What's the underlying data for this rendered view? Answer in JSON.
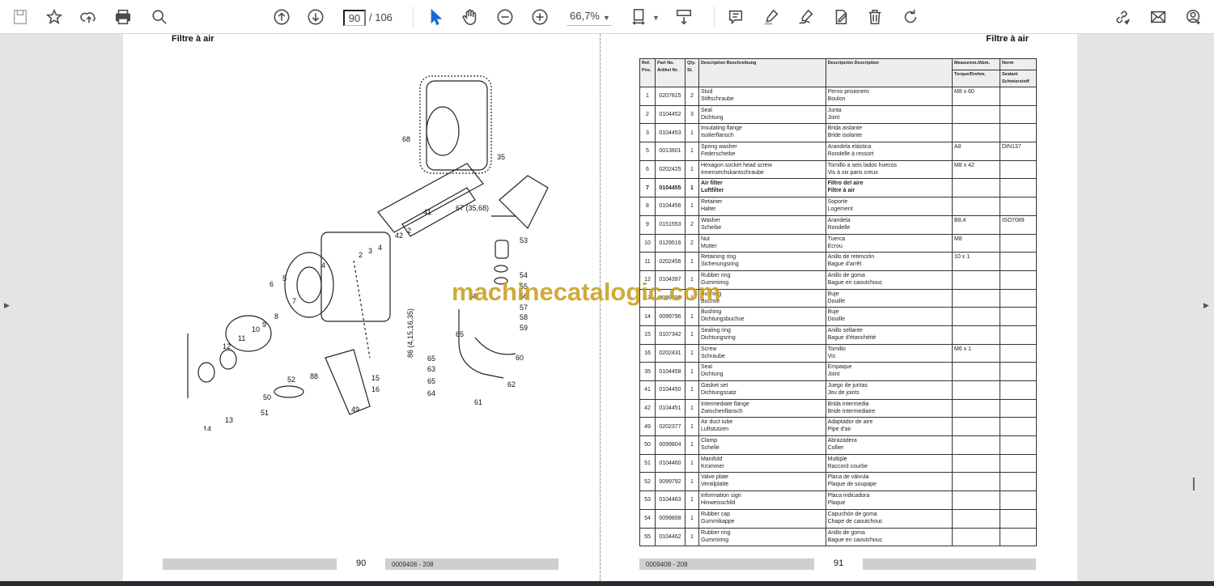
{
  "toolbar": {
    "page_current": "90",
    "page_total": "/ 106",
    "zoom": "66,7%",
    "icons": [
      "save-icon",
      "bookmark-star-icon",
      "upload-icon",
      "print-icon",
      "search-icon",
      "page-up-icon",
      "page-down-icon",
      "select-arrow-icon",
      "hand-icon",
      "zoom-out-icon",
      "zoom-in-icon",
      "fit-page-icon",
      "scroll-mode-icon",
      "comment-icon",
      "highlight-icon",
      "sign-icon",
      "fill-sign-icon",
      "delete-icon",
      "rotate-icon",
      "link-icon",
      "email-icon",
      "account-icon"
    ]
  },
  "left_page": {
    "title": "Filtre à air",
    "figure_id": "wc_ex0114499001_15",
    "page_number": "90",
    "doc_number": "0009408 - 208",
    "callouts": [
      "68",
      "35",
      "41",
      "67 (35,68)",
      "2",
      "42",
      "2",
      "3",
      "4",
      "53",
      "54",
      "55",
      "56",
      "57",
      "58",
      "59",
      "66",
      "60",
      "62",
      "61",
      "65",
      "65",
      "63",
      "65",
      "64",
      "88",
      "15",
      "16",
      "86 (4,15,16,35)",
      "49",
      "50",
      "51",
      "52",
      "14",
      "13",
      "12",
      "11",
      "10",
      "9",
      "8",
      "7",
      "6",
      "5",
      "4"
    ]
  },
  "right_page": {
    "title": "Filtre à air",
    "page_number": "91",
    "doc_number": "0009408 - 208",
    "headers": {
      "ref": "Ref. Pos.",
      "part": "Part No. Artikel Nr.",
      "qty": "Qty. St.",
      "desc": "Description Beschreibung",
      "desc2": "Descripción Description",
      "measure": "Measurem./Abm.",
      "torque": "Torque/Drehm.",
      "norm": "Norm",
      "sealant": "Sealant Schmierstoff"
    },
    "rows": [
      {
        "ref": "1",
        "part": "0207815",
        "qty": "2",
        "en": "Stud",
        "de": "Stiftschraube",
        "es": "Perno prisionero",
        "fr": "Boulon",
        "measure": "M8 x 60",
        "norm": ""
      },
      {
        "ref": "2",
        "part": "0104452",
        "qty": "3",
        "en": "Seal",
        "de": "Dichtung",
        "es": "Junta",
        "fr": "Joint",
        "measure": "",
        "norm": ""
      },
      {
        "ref": "3",
        "part": "0104453",
        "qty": "1",
        "en": "Insulating flange",
        "de": "Isolierflansch",
        "es": "Brida aislante",
        "fr": "Bride isolante",
        "measure": "",
        "norm": ""
      },
      {
        "ref": "5",
        "part": "0013601",
        "qty": "1",
        "en": "Spring washer",
        "de": "Federscheibe",
        "es": "Arandela elástica",
        "fr": "Rondelle à ressort",
        "measure": "A8",
        "norm": "DIN137"
      },
      {
        "ref": "6",
        "part": "0202425",
        "qty": "1",
        "en": "Hexagon socket head screw",
        "de": "Innensechskantschraube",
        "es": "Tornillo a seis lados huecos",
        "fr": "Vis à six pans creux",
        "measure": "M8 x 42",
        "norm": ""
      },
      {
        "ref": "7",
        "part": "0104455",
        "qty": "1",
        "en": "Air filter",
        "de": "Luftfilter",
        "es": "Filtro del aire",
        "fr": "Filtre à air",
        "measure": "",
        "norm": "",
        "bold": true
      },
      {
        "ref": "8",
        "part": "0104456",
        "qty": "1",
        "en": "Retainer",
        "de": "Halter",
        "es": "Soporte",
        "fr": "Logement",
        "measure": "",
        "norm": ""
      },
      {
        "ref": "9",
        "part": "0151553",
        "qty": "2",
        "en": "Washer",
        "de": "Scheibe",
        "es": "Arandela",
        "fr": "Rondelle",
        "measure": "B8,4",
        "norm": "ISO7089"
      },
      {
        "ref": "10",
        "part": "0129516",
        "qty": "2",
        "en": "Nut",
        "de": "Mutter",
        "es": "Tuerca",
        "fr": "Ecrou",
        "measure": "M8",
        "norm": ""
      },
      {
        "ref": "11",
        "part": "0202456",
        "qty": "1",
        "en": "Retaining ring",
        "de": "Sicherungsring",
        "es": "Anillo de retención",
        "fr": "Bague d'arrêt",
        "measure": "10 x 1",
        "norm": ""
      },
      {
        "ref": "12",
        "part": "0104397",
        "qty": "1",
        "en": "Rubber ring",
        "de": "Gummiring",
        "es": "Anillo de goma",
        "fr": "Bague en caoutchouc",
        "measure": "",
        "norm": ""
      },
      {
        "ref": "13",
        "part": "0099795",
        "qty": "1",
        "en": "Bushing",
        "de": "Buchse",
        "es": "Buje",
        "fr": "Douille",
        "measure": "",
        "norm": ""
      },
      {
        "ref": "14",
        "part": "0099796",
        "qty": "1",
        "en": "Bushing",
        "de": "Dichtungsbuchse",
        "es": "Buje",
        "fr": "Douille",
        "measure": "",
        "norm": ""
      },
      {
        "ref": "15",
        "part": "0107342",
        "qty": "1",
        "en": "Sealing ring",
        "de": "Dichtungsring",
        "es": "Anillo sellante",
        "fr": "Bague d'étanchéité",
        "measure": "",
        "norm": ""
      },
      {
        "ref": "16",
        "part": "0202431",
        "qty": "1",
        "en": "Screw",
        "de": "Schraube",
        "es": "Tornillo",
        "fr": "Vis",
        "measure": "M6 x 1",
        "norm": ""
      },
      {
        "ref": "35",
        "part": "0104458",
        "qty": "1",
        "en": "Seal",
        "de": "Dichtung",
        "es": "Empaque",
        "fr": "Joint",
        "measure": "",
        "norm": ""
      },
      {
        "ref": "41",
        "part": "0104450",
        "qty": "1",
        "en": "Gasket set",
        "de": "Dichtungssatz",
        "es": "Juego de juntas",
        "fr": "Jeu de joints",
        "measure": "",
        "norm": ""
      },
      {
        "ref": "42",
        "part": "0104451",
        "qty": "1",
        "en": "Intermediate flange",
        "de": "Zwischenflansch",
        "es": "Brida intermedia",
        "fr": "Bride intermediaire",
        "measure": "",
        "norm": ""
      },
      {
        "ref": "49",
        "part": "0202377",
        "qty": "1",
        "en": "Air duct tube",
        "de": "Luftstutzen",
        "es": "Adaptador de aire",
        "fr": "Pipe d'air",
        "measure": "",
        "norm": ""
      },
      {
        "ref": "50",
        "part": "0099804",
        "qty": "1",
        "en": "Clamp",
        "de": "Schelle",
        "es": "Abrazadera",
        "fr": "Collier",
        "measure": "",
        "norm": ""
      },
      {
        "ref": "51",
        "part": "0104460",
        "qty": "1",
        "en": "Manifold",
        "de": "Krümmer",
        "es": "Multiple",
        "fr": "Raccord courbe",
        "measure": "",
        "norm": ""
      },
      {
        "ref": "52",
        "part": "0099792",
        "qty": "1",
        "en": "Valve plate",
        "de": "Ventilplatte",
        "es": "Placa de válvula",
        "fr": "Plaque de soupape",
        "measure": "",
        "norm": ""
      },
      {
        "ref": "53",
        "part": "0104463",
        "qty": "1",
        "en": "Information sign",
        "de": "Hinweisschild",
        "es": "Placa indicadora",
        "fr": "Plaque",
        "measure": "",
        "norm": ""
      },
      {
        "ref": "54",
        "part": "0099808",
        "qty": "1",
        "en": "Rubber cap",
        "de": "Gummikappe",
        "es": "Capuchón de goma",
        "fr": "Chape de caoutchouc",
        "measure": "",
        "norm": ""
      },
      {
        "ref": "55",
        "part": "0104462",
        "qty": "1",
        "en": "Rubber ring",
        "de": "Gummiring",
        "es": "Anillo de goma",
        "fr": "Bague en caoutchouc",
        "measure": "",
        "norm": ""
      }
    ]
  },
  "watermark": "machinecatalogic.com"
}
